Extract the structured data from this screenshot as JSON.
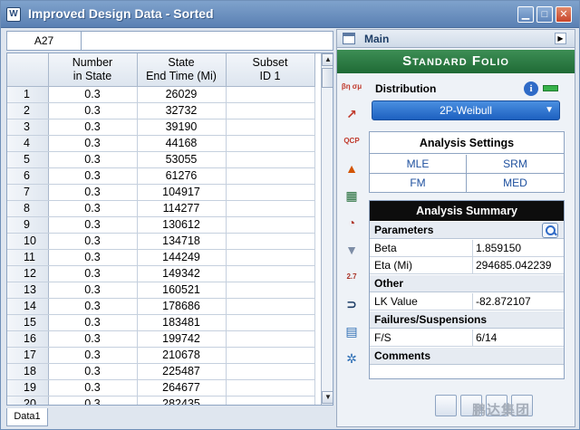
{
  "window": {
    "title": "Improved Design Data - Sorted",
    "app_icon_glyph": "W"
  },
  "cellbar": {
    "cell_ref": "A27",
    "formula_value": ""
  },
  "grid": {
    "headers": [
      [
        "Number",
        "in State"
      ],
      [
        "State",
        "End Time (Mi)"
      ],
      [
        "Subset",
        "ID 1"
      ]
    ],
    "rows": [
      {
        "row": "1",
        "number": "0.3",
        "time": "26029",
        "subset": ""
      },
      {
        "row": "2",
        "number": "0.3",
        "time": "32732",
        "subset": ""
      },
      {
        "row": "3",
        "number": "0.3",
        "time": "39190",
        "subset": ""
      },
      {
        "row": "4",
        "number": "0.3",
        "time": "44168",
        "subset": ""
      },
      {
        "row": "5",
        "number": "0.3",
        "time": "53055",
        "subset": ""
      },
      {
        "row": "6",
        "number": "0.3",
        "time": "61276",
        "subset": ""
      },
      {
        "row": "7",
        "number": "0.3",
        "time": "104917",
        "subset": ""
      },
      {
        "row": "8",
        "number": "0.3",
        "time": "114277",
        "subset": ""
      },
      {
        "row": "9",
        "number": "0.3",
        "time": "130612",
        "subset": ""
      },
      {
        "row": "10",
        "number": "0.3",
        "time": "134718",
        "subset": ""
      },
      {
        "row": "11",
        "number": "0.3",
        "time": "144249",
        "subset": ""
      },
      {
        "row": "12",
        "number": "0.3",
        "time": "149342",
        "subset": ""
      },
      {
        "row": "13",
        "number": "0.3",
        "time": "160521",
        "subset": ""
      },
      {
        "row": "14",
        "number": "0.3",
        "time": "178686",
        "subset": ""
      },
      {
        "row": "15",
        "number": "0.3",
        "time": "183481",
        "subset": ""
      },
      {
        "row": "16",
        "number": "0.3",
        "time": "199742",
        "subset": ""
      },
      {
        "row": "17",
        "number": "0.3",
        "time": "210678",
        "subset": ""
      },
      {
        "row": "18",
        "number": "0.3",
        "time": "225487",
        "subset": ""
      },
      {
        "row": "19",
        "number": "0.3",
        "time": "264677",
        "subset": ""
      },
      {
        "row": "20",
        "number": "0.3",
        "time": "282435",
        "subset": ""
      }
    ],
    "sheet_tab": "Data1"
  },
  "panel": {
    "header_label": "Main",
    "folio_title": "Standard Folio",
    "distribution": {
      "title": "Distribution",
      "selected": "2P-Weibull"
    },
    "analysis_settings": {
      "title": "Analysis Settings",
      "options": [
        "MLE",
        "SRM",
        "FM",
        "MED"
      ]
    },
    "analysis_summary": {
      "title": "Analysis Summary",
      "parameters_label": "Parameters",
      "beta_label": "Beta",
      "beta_value": "1.859150",
      "eta_label": "Eta (Mi)",
      "eta_value": "294685.042239",
      "other_label": "Other",
      "lk_label": "LK Value",
      "lk_value": "-82.872107",
      "failures_label": "Failures/Suspensions",
      "fs_label": "F/S",
      "fs_value": "6/14",
      "comments_label": "Comments"
    },
    "tool_icons": [
      {
        "name": "parameters-icon",
        "glyph": "βη σμ"
      },
      {
        "name": "plot-icon",
        "glyph": "↗"
      },
      {
        "name": "qcp-icon",
        "glyph": "QCP"
      },
      {
        "name": "chart-icon",
        "glyph": "▲"
      },
      {
        "name": "grid-icon",
        "glyph": "▦"
      },
      {
        "name": "gauge-icon",
        "glyph": "◔"
      },
      {
        "name": "filter-icon",
        "glyph": "▼"
      },
      {
        "name": "calculator-icon",
        "glyph": "2.7"
      },
      {
        "name": "transfer-icon",
        "glyph": "⊃"
      },
      {
        "name": "report-icon",
        "glyph": "▤"
      },
      {
        "name": "wizard-icon",
        "glyph": "✲"
      }
    ]
  },
  "watermark": "鹏达集团",
  "colors": {
    "titlebar": "#5a80b3",
    "folio_banner": "#1f6a35",
    "distribution_select": "#1d60c0",
    "summary_header": "#0d0d0d"
  }
}
